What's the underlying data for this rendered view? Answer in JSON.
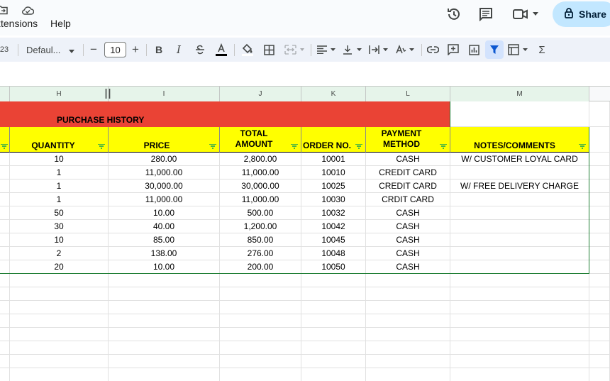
{
  "menu": {
    "items": [
      "xtensions",
      "Help"
    ]
  },
  "right_actions": {
    "share_label": "Share"
  },
  "toolbar": {
    "zoom_partial": "23",
    "font_name": "Defaul...",
    "font_size": "10",
    "decrease_label": "−",
    "increase_label": "+",
    "bold_label": "B",
    "italic_label": "I",
    "sum_label": "Σ"
  },
  "columns": [
    {
      "id": "H",
      "label": "H"
    },
    {
      "id": "I",
      "label": "I"
    },
    {
      "id": "J",
      "label": "J"
    },
    {
      "id": "K",
      "label": "K"
    },
    {
      "id": "L",
      "label": "L"
    },
    {
      "id": "M",
      "label": "M"
    }
  ],
  "sheet": {
    "title": "PURCHASE HISTORY",
    "headers": {
      "quantity": "QUANTITY",
      "price": "PRICE",
      "total_amount_1": "TOTAL",
      "total_amount_2": "AMOUNT",
      "order_no": "ORDER NO.",
      "payment_1": "PAYMENT",
      "payment_2": "METHOD",
      "notes": "NOTES/COMMENTS"
    },
    "rows": [
      {
        "qty": "10",
        "price": "280.00",
        "total": "2,800.00",
        "order": "10001",
        "method": "CASH",
        "notes": "W/ CUSTOMER LOYAL CARD"
      },
      {
        "qty": "1",
        "price": "11,000.00",
        "total": "11,000.00",
        "order": "10010",
        "method": "CREDIT CARD",
        "notes": ""
      },
      {
        "qty": "1",
        "price": "30,000.00",
        "total": "30,000.00",
        "order": "10025",
        "method": "CREDIT CARD",
        "notes": "W/ FREE DELIVERY CHARGE"
      },
      {
        "qty": "1",
        "price": "11,000.00",
        "total": "11,000.00",
        "order": "10030",
        "method": "CRDIT CARD",
        "notes": ""
      },
      {
        "qty": "50",
        "price": "10.00",
        "total": "500.00",
        "order": "10032",
        "method": "CASH",
        "notes": ""
      },
      {
        "qty": "30",
        "price": "40.00",
        "total": "1,200.00",
        "order": "10042",
        "method": "CASH",
        "notes": ""
      },
      {
        "qty": "10",
        "price": "85.00",
        "total": "850.00",
        "order": "10045",
        "method": "CASH",
        "notes": ""
      },
      {
        "qty": "2",
        "price": "138.00",
        "total": "276.00",
        "order": "10048",
        "method": "CASH",
        "notes": ""
      },
      {
        "qty": "20",
        "price": "10.00",
        "total": "200.00",
        "order": "10050",
        "method": "CASH",
        "notes": ""
      }
    ]
  },
  "colors": {
    "title_band": "#ea4335",
    "header_fill": "#ffff00",
    "filter_icon": "#0f9d58",
    "share_bg": "#c2e7ff",
    "table_border": "#1e7e34"
  }
}
